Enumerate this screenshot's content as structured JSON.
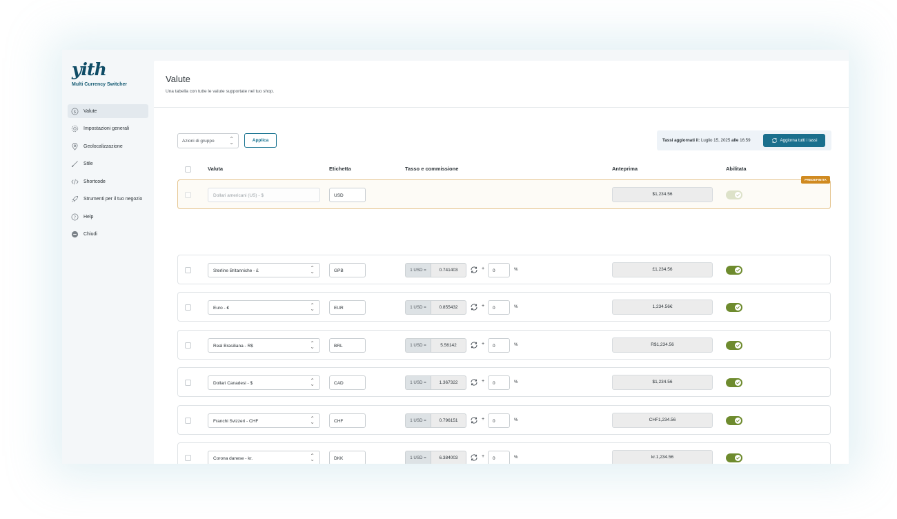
{
  "sidebar": {
    "logo": "yith",
    "plugin_name": "Multi Currency Switcher",
    "items": [
      {
        "label": "Valute",
        "icon": "dollar-circle-icon"
      },
      {
        "label": "Impostazioni generali",
        "icon": "gear-icon"
      },
      {
        "label": "Geolocalizzazione",
        "icon": "map-pin-icon"
      },
      {
        "label": "Stile",
        "icon": "brush-icon"
      },
      {
        "label": "Shortcode",
        "icon": "code-icon"
      },
      {
        "label": "Strumenti per il tuo negozio",
        "icon": "rocket-icon"
      },
      {
        "label": "Help",
        "icon": "help-circle-icon"
      },
      {
        "label": "Chiudi",
        "icon": "minus-circle-icon"
      }
    ]
  },
  "header": {
    "title": "Valute",
    "subtitle": "Una tabella con tutte le valute supportate nel tuo shop."
  },
  "toolbar": {
    "bulk_actions": "Azioni di gruppo",
    "apply": "Applica",
    "rates_label": "Tassi aggiornati il:",
    "rates_date": "Luglio 15, 2025",
    "rates_at": "alle",
    "rates_time": "16:59",
    "update_all": "Aggiorna tutti i tassi"
  },
  "table": {
    "headers": {
      "currency": "Valuta",
      "label": "Etichetta",
      "rate": "Tasso e commissione",
      "preview": "Anteprima",
      "enabled": "Abilitata"
    },
    "default_badge": "PREDEFINITA",
    "rows": [
      {
        "currency": "Dollari americani (US) - $",
        "label": "USD",
        "preview": "$1,234.56"
      },
      {
        "currency": "Sterline Britanniche - £",
        "label": "GPB",
        "rate_prefix": "1 USD =",
        "rate": "0.741403",
        "plus": "+",
        "fee": "0",
        "pct": "%",
        "preview": "£1,234.56"
      },
      {
        "currency": "Euro - €",
        "label": "EUR",
        "rate_prefix": "1 USD =",
        "rate": "0.855432",
        "plus": "+",
        "fee": "0",
        "pct": "%",
        "preview": "1,234.56€"
      },
      {
        "currency": "Real Brasiliana - R$",
        "label": "BRL",
        "rate_prefix": "1 USD =",
        "rate": "5.56142",
        "plus": "+",
        "fee": "0",
        "pct": "%",
        "preview": "R$1,234.56"
      },
      {
        "currency": "Dollari Canadesi - $",
        "label": "CAD",
        "rate_prefix": "1 USD =",
        "rate": "1.367322",
        "plus": "+",
        "fee": "0",
        "pct": "%",
        "preview": "$1,234.56"
      },
      {
        "currency": "Franchi Svizzeri - CHF",
        "label": "CHF",
        "rate_prefix": "1 USD =",
        "rate": "0.796151",
        "plus": "+",
        "fee": "0",
        "pct": "%",
        "preview": "CHF1,234.56"
      },
      {
        "currency": "Corona danese - kr.",
        "label": "DKK",
        "rate_prefix": "1 USD =",
        "rate": "6.384003",
        "plus": "+",
        "fee": "0",
        "pct": "%",
        "preview": "kr.1,234.56"
      }
    ]
  },
  "colors": {
    "brand": "#0f4c66",
    "primary_button": "#1a6f8d",
    "toggle_on": "#6e8b2e",
    "default_badge": "#d08a20"
  }
}
